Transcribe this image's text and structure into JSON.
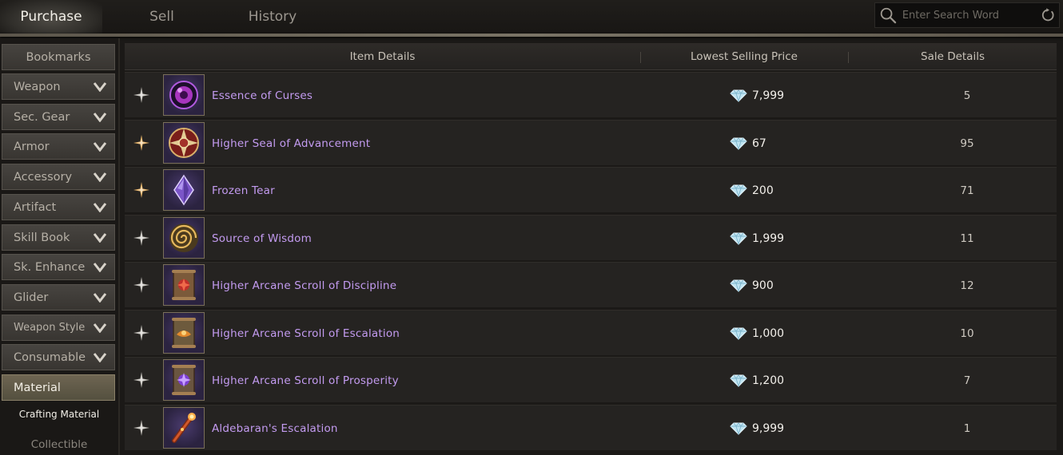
{
  "tabs": [
    {
      "label": "Purchase",
      "active": true
    },
    {
      "label": "Sell",
      "active": false
    },
    {
      "label": "History",
      "active": false
    }
  ],
  "search": {
    "placeholder": "Enter Search Word",
    "value": ""
  },
  "sidebar": {
    "bookmarks": "Bookmarks",
    "categories": [
      {
        "label": "Weapon"
      },
      {
        "label": "Sec. Gear"
      },
      {
        "label": "Armor"
      },
      {
        "label": "Accessory"
      },
      {
        "label": "Artifact"
      },
      {
        "label": "Skill Book"
      },
      {
        "label": "Sk. Enhance"
      },
      {
        "label": "Glider"
      },
      {
        "label": "Weapon Style"
      },
      {
        "label": "Consumable"
      }
    ],
    "active_category": "Material",
    "subcategories": [
      {
        "label": "Crafting Material",
        "selected": true
      },
      {
        "label": "Collectible",
        "selected": false
      }
    ]
  },
  "table": {
    "headers": {
      "item": "Item Details",
      "price": "Lowest Selling Price",
      "sale": "Sale Details"
    },
    "rows": [
      {
        "name": "Essence of Curses",
        "price": "7,999",
        "sale": "5",
        "bookmarked": false,
        "icon": "purple-orb-icon"
      },
      {
        "name": "Higher Seal of Advancement",
        "price": "67",
        "sale": "95",
        "bookmarked": true,
        "icon": "seal-medallion-icon"
      },
      {
        "name": "Frozen Tear",
        "price": "200",
        "sale": "71",
        "bookmarked": true,
        "icon": "violet-teardrop-gem-icon"
      },
      {
        "name": "Source of Wisdom",
        "price": "1,999",
        "sale": "11",
        "bookmarked": false,
        "icon": "golden-swirl-icon"
      },
      {
        "name": "Higher Arcane Scroll of Discipline",
        "price": "900",
        "sale": "12",
        "bookmarked": false,
        "icon": "red-scroll-icon"
      },
      {
        "name": "Higher Arcane Scroll of Escalation",
        "price": "1,000",
        "sale": "10",
        "bookmarked": false,
        "icon": "orange-scroll-icon"
      },
      {
        "name": "Higher Arcane Scroll of Prosperity",
        "price": "1,200",
        "sale": "7",
        "bookmarked": false,
        "icon": "purple-scroll-icon"
      },
      {
        "name": "Aldebaran's Escalation",
        "price": "9,999",
        "sale": "1",
        "bookmarked": false,
        "icon": "fire-staff-icon"
      }
    ]
  },
  "colors": {
    "item_name": "#c39bf0",
    "bookmark_active": "#e7b46a",
    "bookmark_inactive": "#bdbab4",
    "subcategory_selected": "#f2efe8",
    "subcategory_unselected": "#8b867e"
  }
}
